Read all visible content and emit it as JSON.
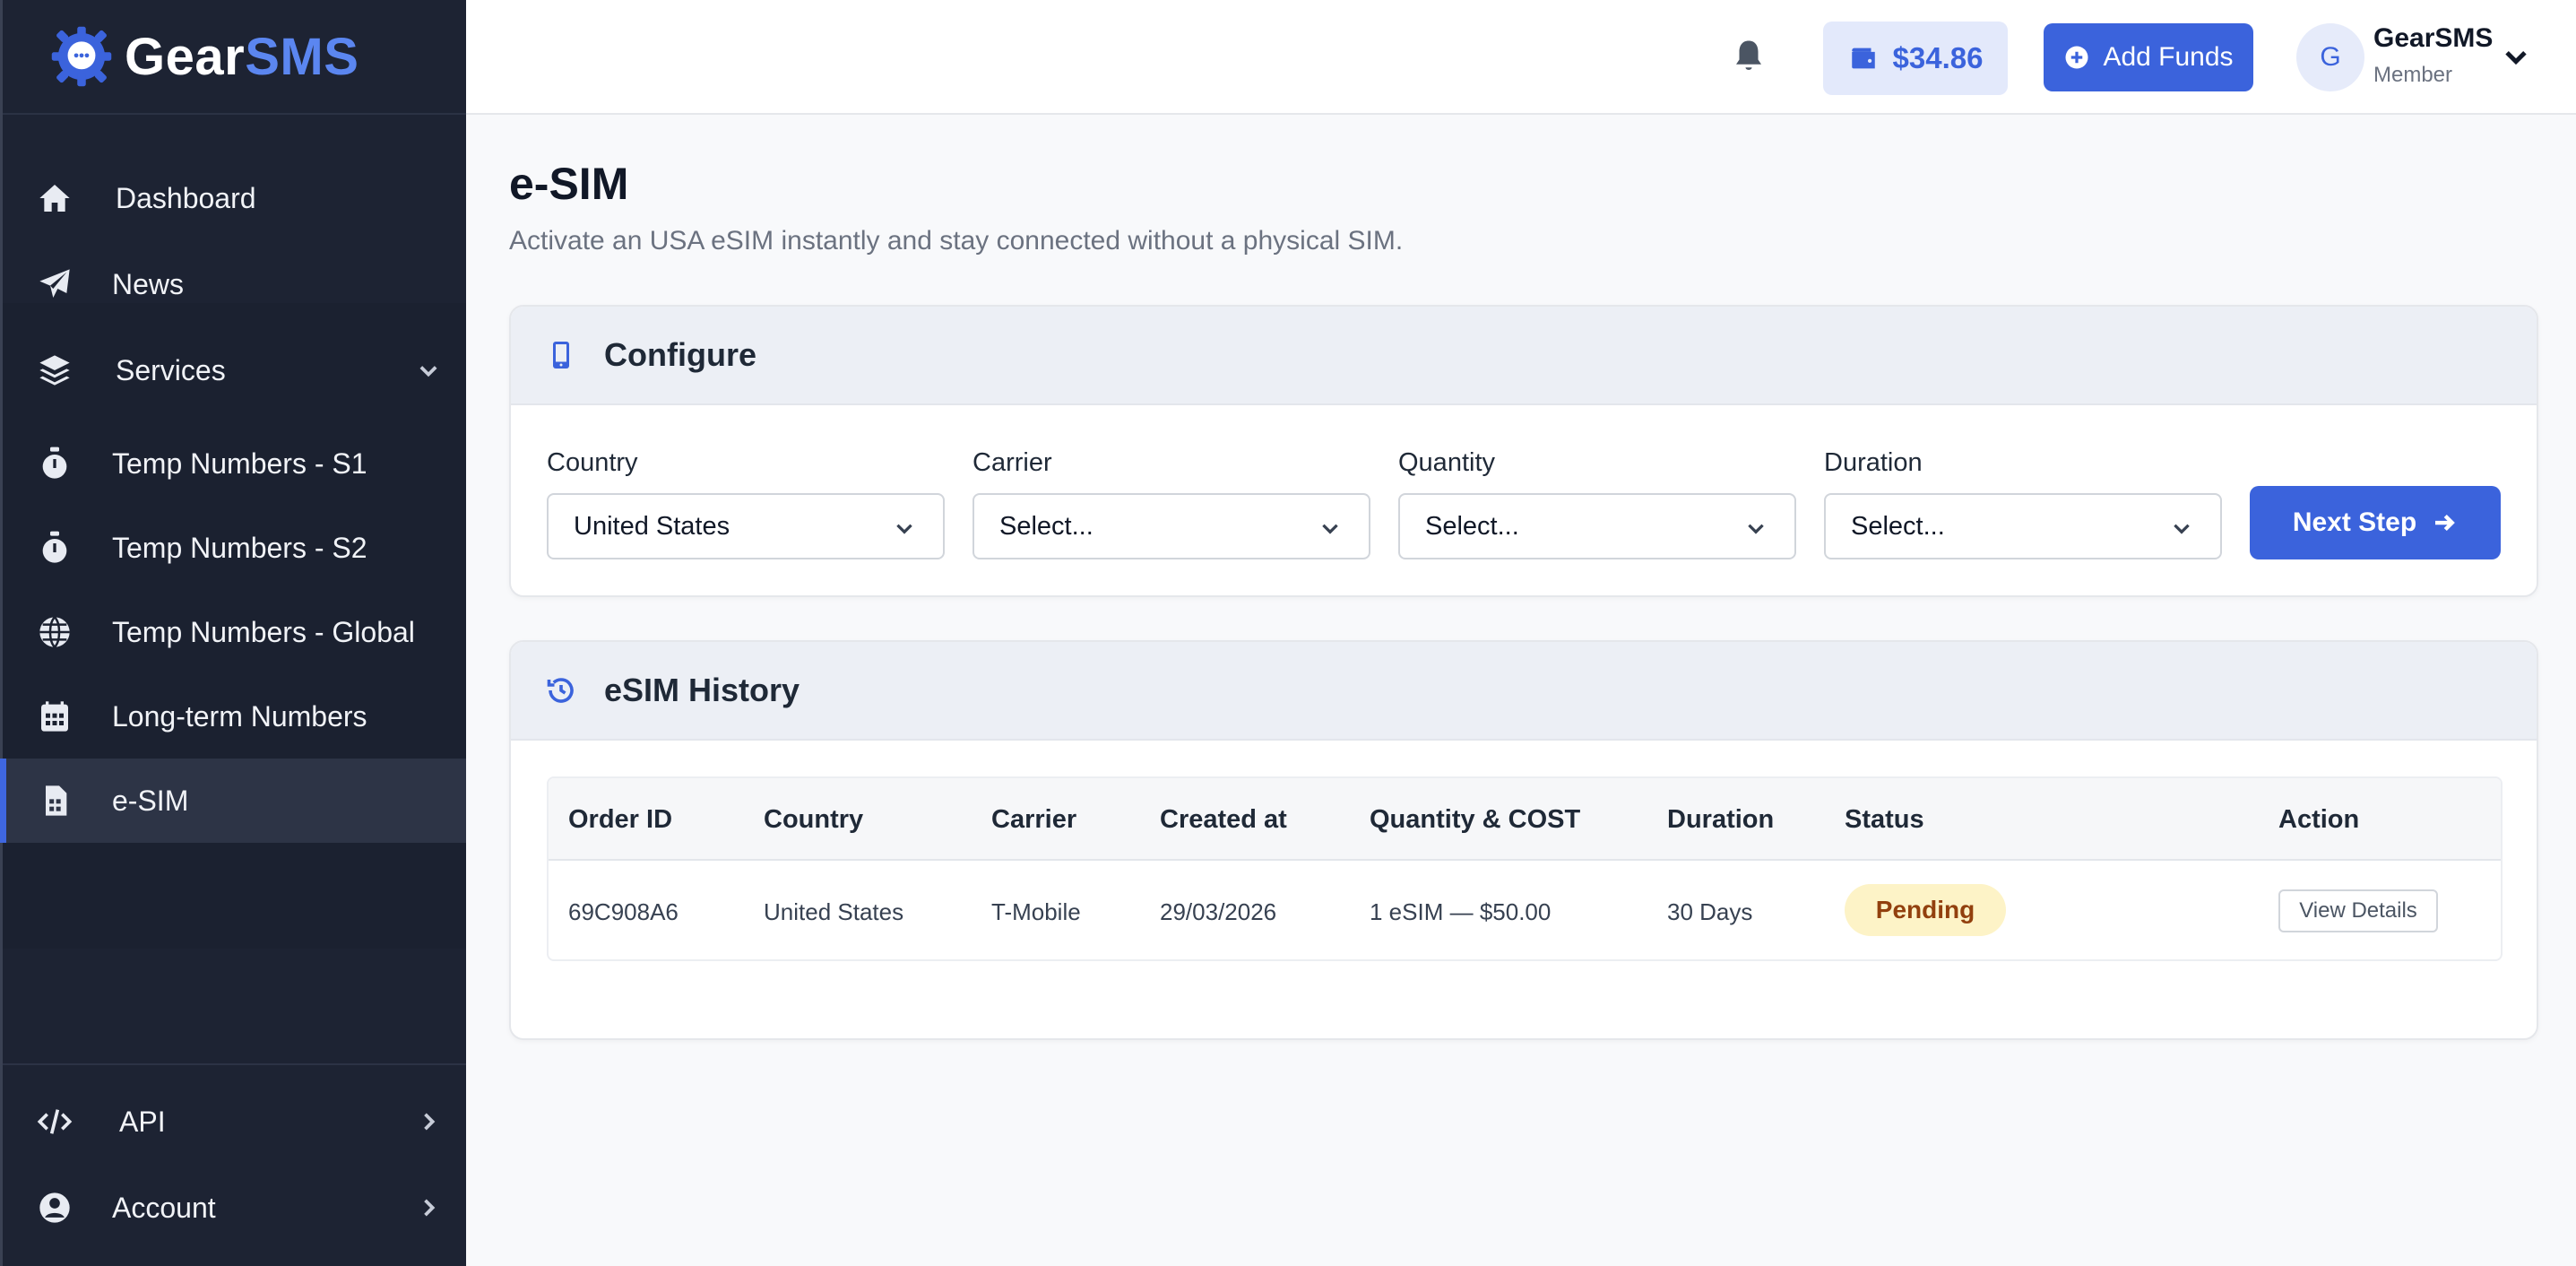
{
  "brand": {
    "name_part1": "Gear",
    "name_part2": "SMS",
    "logo_icon": "gear-chat-icon"
  },
  "sidebar": {
    "items": [
      {
        "label": "Dashboard",
        "icon": "home-icon"
      },
      {
        "label": "News",
        "icon": "paper-plane-icon"
      },
      {
        "label": "Services",
        "icon": "layers-icon"
      },
      {
        "label": "Temp Numbers - S1",
        "icon": "stopwatch-icon"
      },
      {
        "label": "Temp Numbers - S2",
        "icon": "stopwatch-icon"
      },
      {
        "label": "Temp Numbers - Global",
        "icon": "globe-icon"
      },
      {
        "label": "Long-term Numbers",
        "icon": "calendar-icon"
      },
      {
        "label": "e-SIM",
        "icon": "sim-card-icon",
        "active": true
      }
    ],
    "bottom_items": [
      {
        "label": "API",
        "icon": "code-icon"
      },
      {
        "label": "Account",
        "icon": "user-circle-icon"
      }
    ]
  },
  "header": {
    "balance": "$34.86",
    "add_funds_label": "Add Funds",
    "user": {
      "initial": "G",
      "name": "GearSMS",
      "role": "Member"
    }
  },
  "page": {
    "title": "e-SIM",
    "subtitle": "Activate an USA eSIM instantly and stay connected without a physical SIM."
  },
  "configure": {
    "title": "Configure",
    "fields": [
      {
        "label": "Country",
        "value": "United States"
      },
      {
        "label": "Carrier",
        "value": "Select..."
      },
      {
        "label": "Quantity",
        "value": "Select..."
      },
      {
        "label": "Duration",
        "value": "Select..."
      }
    ],
    "next_label": "Next Step"
  },
  "history": {
    "title": "eSIM History",
    "columns": [
      "Order ID",
      "Country",
      "Carrier",
      "Created at",
      "Quantity & COST",
      "Duration",
      "Status",
      "Action"
    ],
    "rows": [
      {
        "order_id": "69C908A6",
        "country": "United States",
        "carrier": "T-Mobile",
        "created_at": "29/03/2026",
        "quantity_cost": "1 eSIM — $50.00",
        "duration": "30 Days",
        "status": "Pending",
        "action": "View Details"
      }
    ]
  },
  "colors": {
    "sidebar_bg": "#1d2333",
    "accent": "#3b63dc",
    "pending_bg": "#fdf3c7",
    "pending_text": "#92400e"
  }
}
